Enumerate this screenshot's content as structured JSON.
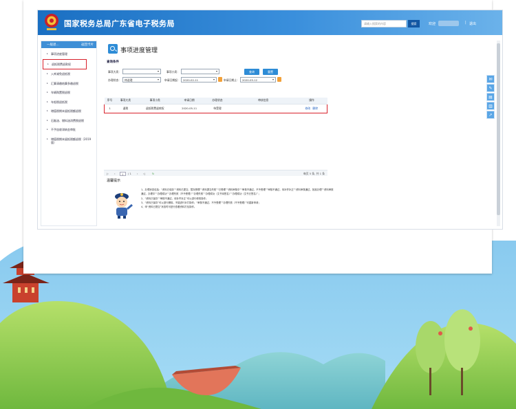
{
  "header": {
    "title": "国家税务总局广东省电子税务局",
    "search_placeholder": "请输入搜索的内容",
    "search_button": "搜索",
    "welcome": "欢迎",
    "separator": "|",
    "logout": "退出"
  },
  "sidebar": {
    "back_label": "一般退...",
    "return_label": "返回卡片",
    "items": [
      {
        "label": "事项进度管理"
      },
      {
        "label": "退抵税费退款权"
      },
      {
        "label": "入库减免退抵税"
      },
      {
        "label": "汇算清缴结算多缴退税"
      },
      {
        "label": "车辆购置税退税"
      },
      {
        "label": "车船税退抵税"
      },
      {
        "label": "增值税期末留抵税额退税"
      },
      {
        "label": "石脑油、燃料油消费税退税"
      },
      {
        "label": "不予加收滞纳金审批"
      },
      {
        "label": "增值税期末留抵税额退税（2019版）"
      }
    ],
    "active_index": 1
  },
  "main": {
    "title": "事项进度管理",
    "query_section": "查询条件",
    "filters": {
      "category_label": "事项大类：",
      "category_value": "",
      "subtype_label": "事项小类：",
      "subtype_value": "",
      "status_label": "办理状态：",
      "status_value": "待送理",
      "apply_start_label": "申请日期起：",
      "apply_start_value": "2020-02-11",
      "apply_end_label": "申请日期止：",
      "apply_end_value": "2020-05-12"
    },
    "buttons": {
      "query": "查询",
      "reset": "重置"
    },
    "table": {
      "columns": [
        "序号",
        "事项大类",
        "事项小类",
        "申请日期",
        "办理状态",
        "审核信息",
        "操作"
      ],
      "rows": [
        {
          "no": "1",
          "category": "退税",
          "subtype": "退抵税费退款权",
          "date": "2020-05-11",
          "status": "待受理",
          "review": "",
          "actions": [
            "修改",
            "删除"
          ]
        }
      ]
    },
    "pager": {
      "first": "|‹",
      "prev": "‹",
      "page": "1",
      "total": "/ 1",
      "next": "›",
      "last": "›|",
      "refresh": "↻",
      "summary": "每页 5 条, 共 1 条"
    },
    "warm_tips_title": "温馨提示",
    "tips": [
      "1、办理状态包括：“资料已保存”“资料已提交，暂存受理”“资料提交失败”“已受理”“资料审核中”“审核不通过，不予受理”“审核不通过，待补齐补正”“资料审核通过，批准办理”“资料审核通过，办理中”“办理成功”“办理失败（不予受理）”“办理失败”“办理成功（文书待签名）”“办理成功（文书已签名）”；",
      "2、“资料已保存”“审核不通过，待补齐补正”可以进行修改操作；",
      "3、“资料已保存”可以进行删除，不能进行补打操作；“审核不通过，不予受理”“办理失败（不予受理）”可重新申请；",
      "4、申“资料已提交”状态时可进行查看资料打包操作。"
    ]
  },
  "side_tools": [
    "message-icon",
    "edit-icon",
    "document-icon",
    "chart-icon",
    "share-icon"
  ],
  "colors": {
    "header_blue": "#1a6fc2",
    "accent": "#2e8cd6",
    "highlight_red": "#d8202a",
    "sky": "#7cc3ea",
    "hills": "#8fcf54"
  }
}
